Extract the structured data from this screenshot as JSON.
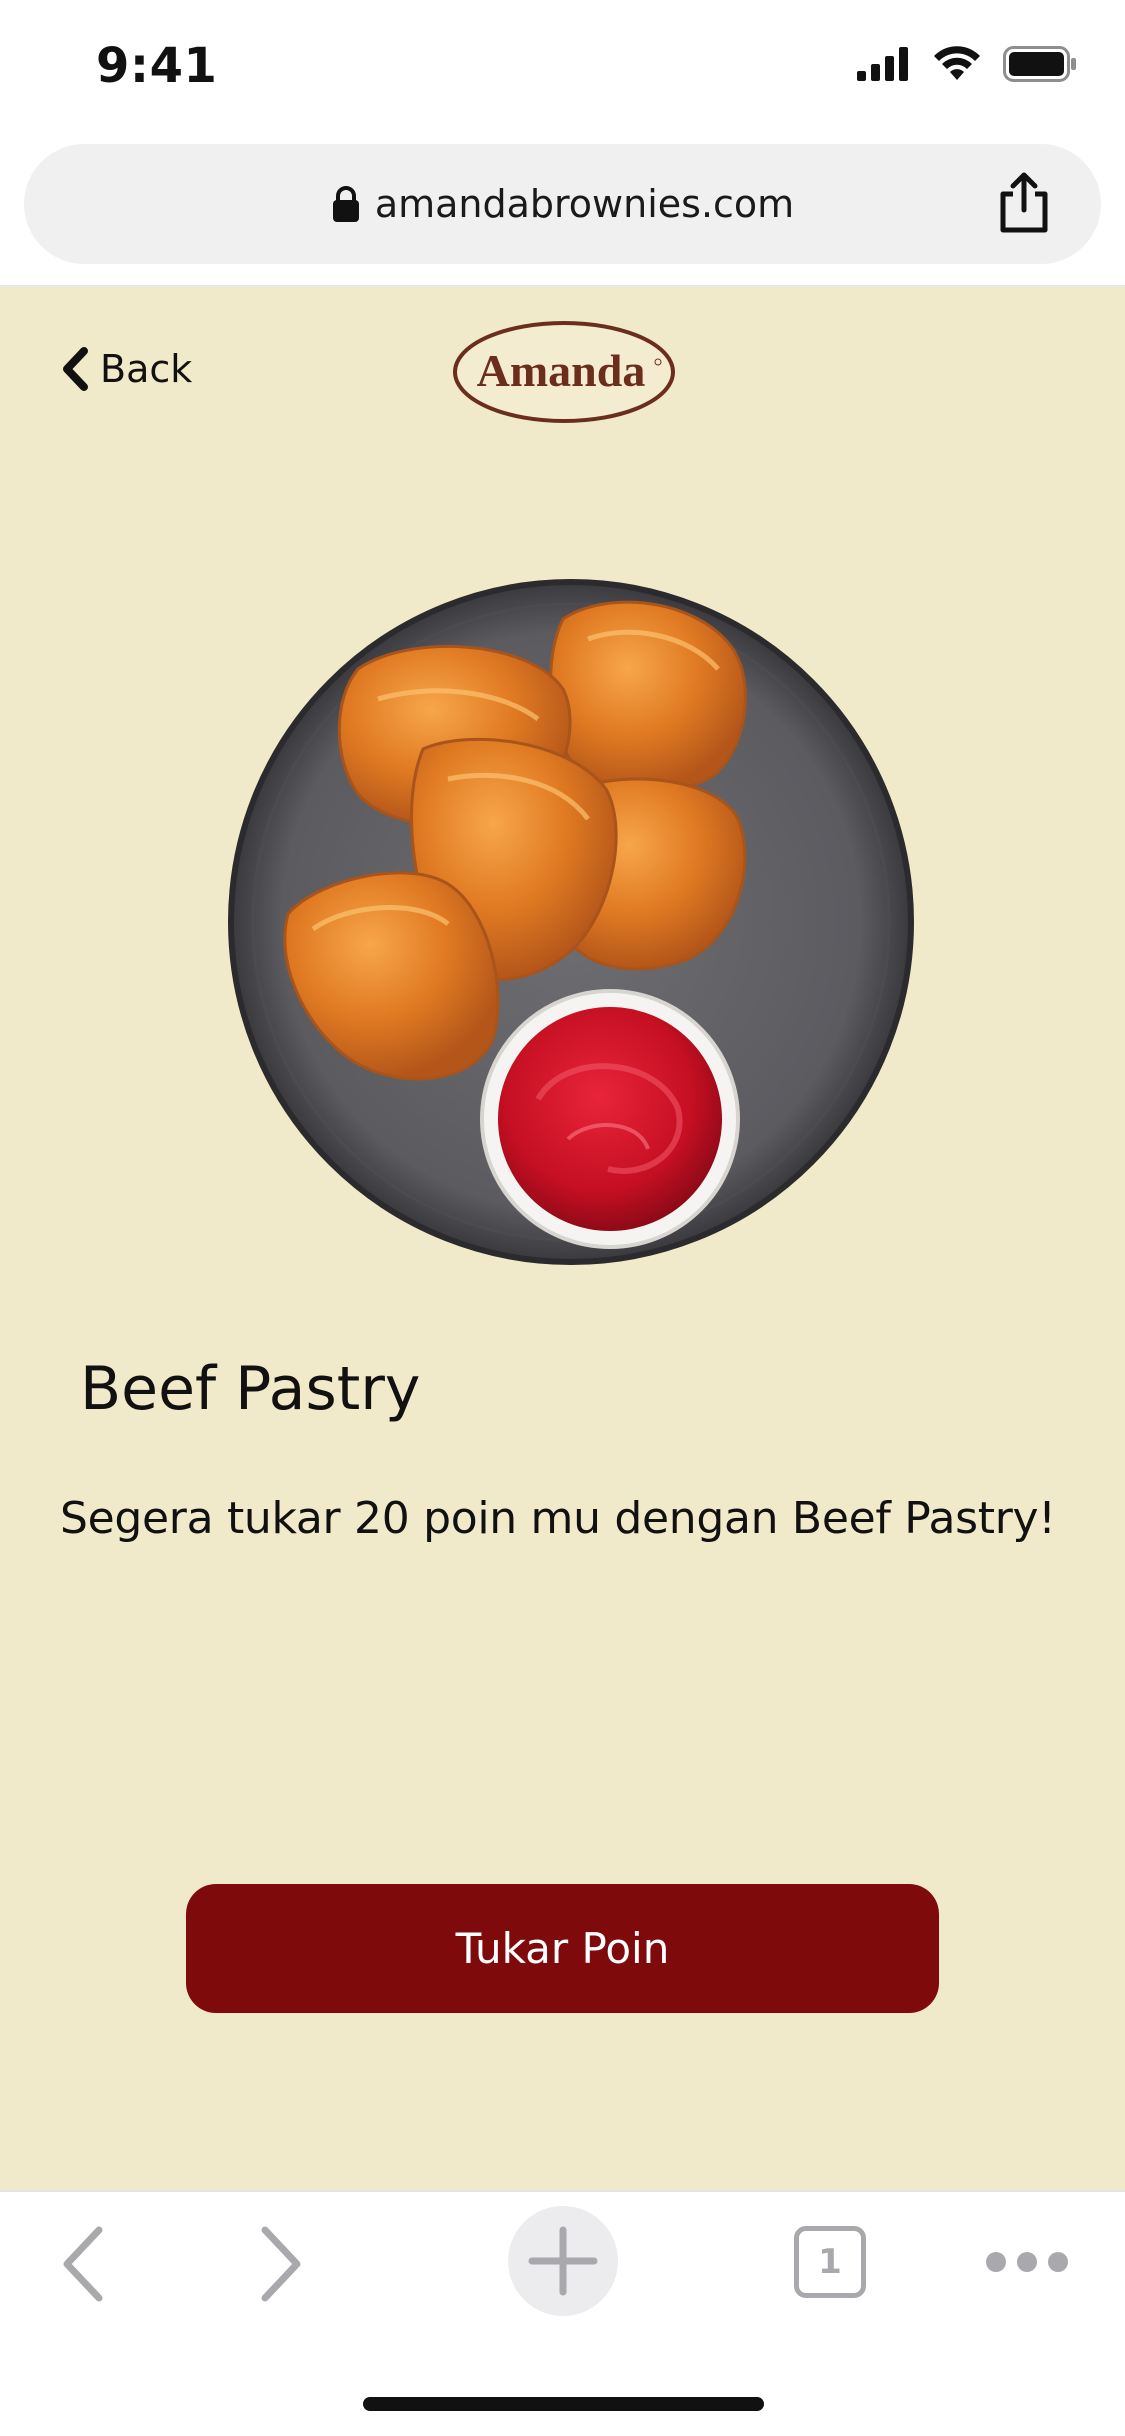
{
  "status_bar": {
    "time": "9:41",
    "icons": [
      "signal-icon",
      "wifi-icon",
      "battery-icon"
    ]
  },
  "browser": {
    "url": "amandabrownies.com",
    "lock_icon": "lock-icon",
    "share_icon": "share-icon",
    "toolbar": {
      "back_icon": "chevron-left-icon",
      "forward_icon": "chevron-right-icon",
      "new_tab_icon": "plus-icon",
      "tab_count": "1",
      "more_icon": "more-icon"
    }
  },
  "page": {
    "back_label": "Back",
    "logo_text": "Amanda",
    "product": {
      "title": "Beef Pastry",
      "description": "Segera tukar 20 poin mu dengan Beef Pastry!"
    },
    "cta_label": "Tukar Poin"
  },
  "colors": {
    "page_background": "#f1eaca",
    "cta_background": "#7e0a0b",
    "logo_brown": "#6b2e1c"
  }
}
